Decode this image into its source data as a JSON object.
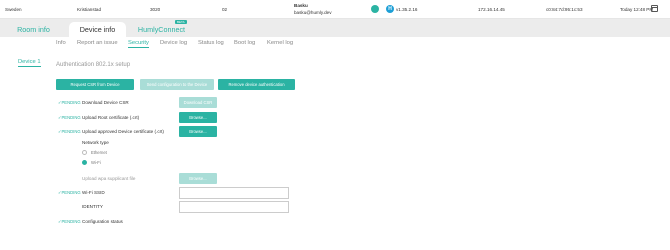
{
  "topbar": {
    "country": "Sweden",
    "street": "Kristianstad",
    "postcode": "3020",
    "floor": "02",
    "user_name": "Basku",
    "user_email": "basku@humly.dev",
    "firmware": "v1.35.2.16",
    "ip": "172.16.14.45",
    "mac": "c0:84:7d:95:1c:53",
    "datetime": "Today 12:48 PM"
  },
  "main_tabs": [
    {
      "label": "Room info"
    },
    {
      "label": "Device info"
    },
    {
      "label": "HumlyConnect",
      "badge": "BETA"
    }
  ],
  "sub_tabs": [
    "Info",
    "Report an issue",
    "Security",
    "Device log",
    "Status log",
    "Boot log",
    "Kernel log"
  ],
  "device_tab": "Device 1",
  "section_title": "Authentication 802.1x setup",
  "actions": {
    "request_csr": "Request CSR from Device",
    "send_config": "Send configuration to the Device",
    "remove_auth": "Remove device authentication"
  },
  "rows": {
    "download_csr": {
      "status": "PENDING",
      "label": "Download Device CSR",
      "button": "Download CSR"
    },
    "upload_root": {
      "status": "PENDING",
      "label": "Upload Root certificate (.crt)",
      "button": "Browse..."
    },
    "upload_device": {
      "status": "PENDING",
      "label": "Upload approved Device certificate (.crt)",
      "button": "Browse..."
    },
    "network_type": {
      "label": "Network type",
      "options": [
        "Ethernet",
        "Wi-Fi"
      ],
      "selected": "Wi-Fi"
    },
    "wpa_file": {
      "label": "Upload wpa supplicant file",
      "button": "Browse..."
    },
    "wifi_ssid": {
      "status": "PENDING",
      "label": "Wi-Fi SSID",
      "value": ""
    },
    "identity": {
      "label": "IDENTITY",
      "value": ""
    },
    "config_status": {
      "status": "PENDING",
      "label": "Configuration status"
    }
  },
  "colors": {
    "accent": "#2bb3a3",
    "accent_disabled": "#a9ddd7"
  }
}
